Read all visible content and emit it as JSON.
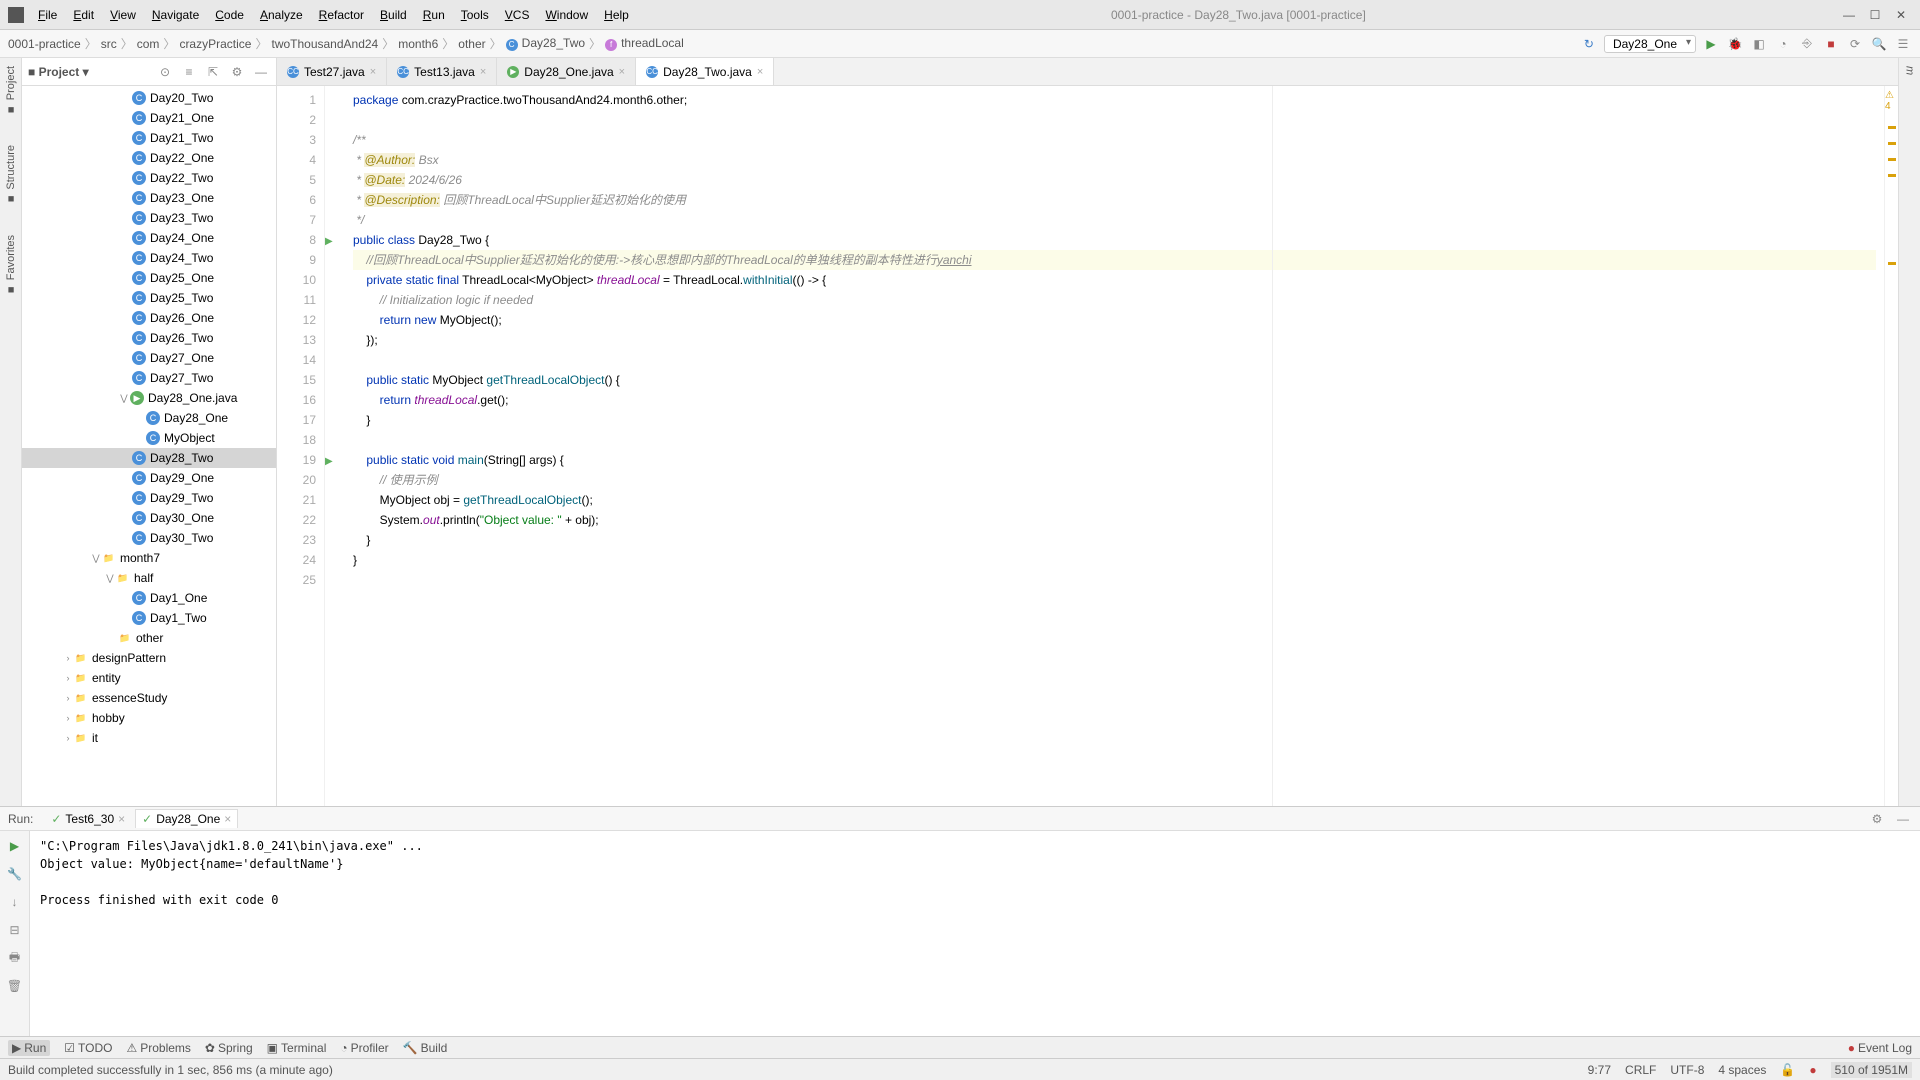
{
  "window": {
    "title": "0001-practice - Day28_Two.java [0001-practice]"
  },
  "menu": [
    "File",
    "Edit",
    "View",
    "Navigate",
    "Code",
    "Analyze",
    "Refactor",
    "Build",
    "Run",
    "Tools",
    "VCS",
    "Window",
    "Help"
  ],
  "breadcrumb": [
    "0001-practice",
    "src",
    "com",
    "crazyPractice",
    "twoThousandAnd24",
    "month6",
    "other",
    "Day28_Two",
    "threadLocal"
  ],
  "runConfig": "Day28_One",
  "projectPanel": {
    "title": "Project"
  },
  "tree": [
    {
      "indent": 110,
      "icon": "class",
      "label": "Day20_Two"
    },
    {
      "indent": 110,
      "icon": "class",
      "label": "Day21_One"
    },
    {
      "indent": 110,
      "icon": "class",
      "label": "Day21_Two"
    },
    {
      "indent": 110,
      "icon": "class",
      "label": "Day22_One"
    },
    {
      "indent": 110,
      "icon": "class",
      "label": "Day22_Two"
    },
    {
      "indent": 110,
      "icon": "class",
      "label": "Day23_One"
    },
    {
      "indent": 110,
      "icon": "class",
      "label": "Day23_Two"
    },
    {
      "indent": 110,
      "icon": "class",
      "label": "Day24_One"
    },
    {
      "indent": 110,
      "icon": "class",
      "label": "Day24_Two"
    },
    {
      "indent": 110,
      "icon": "class",
      "label": "Day25_One"
    },
    {
      "indent": 110,
      "icon": "class",
      "label": "Day25_Two"
    },
    {
      "indent": 110,
      "icon": "class",
      "label": "Day26_One"
    },
    {
      "indent": 110,
      "icon": "class",
      "label": "Day26_Two"
    },
    {
      "indent": 110,
      "icon": "class",
      "label": "Day27_One"
    },
    {
      "indent": 110,
      "icon": "class",
      "label": "Day27_Two"
    },
    {
      "indent": 96,
      "exp": "v",
      "icon": "run",
      "label": "Day28_One.java"
    },
    {
      "indent": 124,
      "icon": "class",
      "label": "Day28_One"
    },
    {
      "indent": 124,
      "icon": "class",
      "label": "MyObject"
    },
    {
      "indent": 110,
      "icon": "class",
      "label": "Day28_Two",
      "selected": true
    },
    {
      "indent": 110,
      "icon": "class",
      "label": "Day29_One"
    },
    {
      "indent": 110,
      "icon": "class",
      "label": "Day29_Two"
    },
    {
      "indent": 110,
      "icon": "class",
      "label": "Day30_One"
    },
    {
      "indent": 110,
      "icon": "class",
      "label": "Day30_Two"
    },
    {
      "indent": 68,
      "exp": "v",
      "icon": "folder",
      "label": "month7"
    },
    {
      "indent": 82,
      "exp": "v",
      "icon": "folder",
      "label": "half"
    },
    {
      "indent": 110,
      "icon": "class",
      "label": "Day1_One"
    },
    {
      "indent": 110,
      "icon": "class",
      "label": "Day1_Two"
    },
    {
      "indent": 96,
      "icon": "folder",
      "label": "other"
    },
    {
      "indent": 40,
      "exp": ">",
      "icon": "folder",
      "label": "designPattern"
    },
    {
      "indent": 40,
      "exp": ">",
      "icon": "folder",
      "label": "entity"
    },
    {
      "indent": 40,
      "exp": ">",
      "icon": "folder",
      "label": "essenceStudy"
    },
    {
      "indent": 40,
      "exp": ">",
      "icon": "folder",
      "label": "hobby"
    },
    {
      "indent": 40,
      "exp": ">",
      "icon": "folder",
      "label": "it"
    }
  ],
  "editorTabs": [
    {
      "label": "Test27.java",
      "icon": "class"
    },
    {
      "label": "Test13.java",
      "icon": "class"
    },
    {
      "label": "Day28_One.java",
      "icon": "run"
    },
    {
      "label": "Day28_Two.java",
      "icon": "class",
      "active": true
    }
  ],
  "code": {
    "lines": [
      {
        "n": 1,
        "html": "<span class='kw'>package</span> com.crazyPractice.twoThousandAnd24.month6.other;"
      },
      {
        "n": 2,
        "html": ""
      },
      {
        "n": 3,
        "html": "<span class='cmt'>/**</span>"
      },
      {
        "n": 4,
        "html": "<span class='cmt'> * </span><span class='ann'>@Author:</span> <span class='cmt'>Bsx</span>"
      },
      {
        "n": 5,
        "html": "<span class='cmt'> * </span><span class='ann'>@Date:</span> <span class='cmt'>2024/6/26</span>"
      },
      {
        "n": 6,
        "html": "<span class='cmt'> * </span><span class='ann'>@Description:</span> <span class='cmt'>回顾ThreadLocal中Supplier延迟初始化的使用</span>"
      },
      {
        "n": 7,
        "html": "<span class='cmt'> */</span>"
      },
      {
        "n": 8,
        "html": "<span class='kw'>public class</span> Day28_Two {",
        "run": true
      },
      {
        "n": 9,
        "html": "    <span class='cmt'>//回顾ThreadLocal中Supplier延迟初始化的使用:->核心思想即内部的ThreadLocal的单独线程的副本特性进行<u>yanchi</u></span>",
        "hl": true
      },
      {
        "n": 10,
        "html": "    <span class='kw'>private static final</span> ThreadLocal&lt;MyObject&gt; <span class='fld'>threadLocal</span> = ThreadLocal.<span class='mtd'>withInitial</span>(() -&gt; {"
      },
      {
        "n": 11,
        "html": "        <span class='cmt'>// Initialization logic if needed</span>"
      },
      {
        "n": 12,
        "html": "        <span class='kw'>return new</span> MyObject();"
      },
      {
        "n": 13,
        "html": "    });"
      },
      {
        "n": 14,
        "html": ""
      },
      {
        "n": 15,
        "html": "    <span class='kw'>public static</span> MyObject <span class='mtd'>getThreadLocalObject</span>() {"
      },
      {
        "n": 16,
        "html": "        <span class='kw'>return</span> <span class='fld'>threadLocal</span>.get();"
      },
      {
        "n": 17,
        "html": "    }"
      },
      {
        "n": 18,
        "html": ""
      },
      {
        "n": 19,
        "html": "    <span class='kw'>public static void</span> <span class='mtd'>main</span>(String[] args) {",
        "run": true
      },
      {
        "n": 20,
        "html": "        <span class='cmt'>// 使用示例</span>"
      },
      {
        "n": 21,
        "html": "        MyObject obj = <span class='mtd'>getThreadLocalObject</span>();"
      },
      {
        "n": 22,
        "html": "        System.<span class='fld'>out</span>.println(<span class='str'>\"Object value: \"</span> + obj);"
      },
      {
        "n": 23,
        "html": "    }"
      },
      {
        "n": 24,
        "html": "}"
      },
      {
        "n": 25,
        "html": ""
      }
    ],
    "warnBadge": "⚠ 4"
  },
  "run": {
    "label": "Run:",
    "tabs": [
      {
        "label": "Test6_30"
      },
      {
        "label": "Day28_One",
        "active": true
      }
    ],
    "output": "\"C:\\Program Files\\Java\\jdk1.8.0_241\\bin\\java.exe\" ...\nObject value: MyObject{name='defaultName'}\n\nProcess finished with exit code 0"
  },
  "bottomTools": [
    {
      "label": "Run",
      "icon": "▶",
      "active": true
    },
    {
      "label": "TODO",
      "icon": "☑"
    },
    {
      "label": "Problems",
      "icon": "⚠"
    },
    {
      "label": "Spring",
      "icon": "✿"
    },
    {
      "label": "Terminal",
      "icon": "▣"
    },
    {
      "label": "Profiler",
      "icon": "◔"
    },
    {
      "label": "Build",
      "icon": "🔨"
    }
  ],
  "eventLog": "Event Log",
  "status": {
    "left": "Build completed successfully in 1 sec, 856 ms (a minute ago)",
    "pos": "9:77",
    "lineSep": "CRLF",
    "encoding": "UTF-8",
    "indent": "4 spaces",
    "heap": "510 of 1951M"
  },
  "leftSide": [
    "Project",
    "Structure",
    "Favorites"
  ],
  "rightSide": []
}
